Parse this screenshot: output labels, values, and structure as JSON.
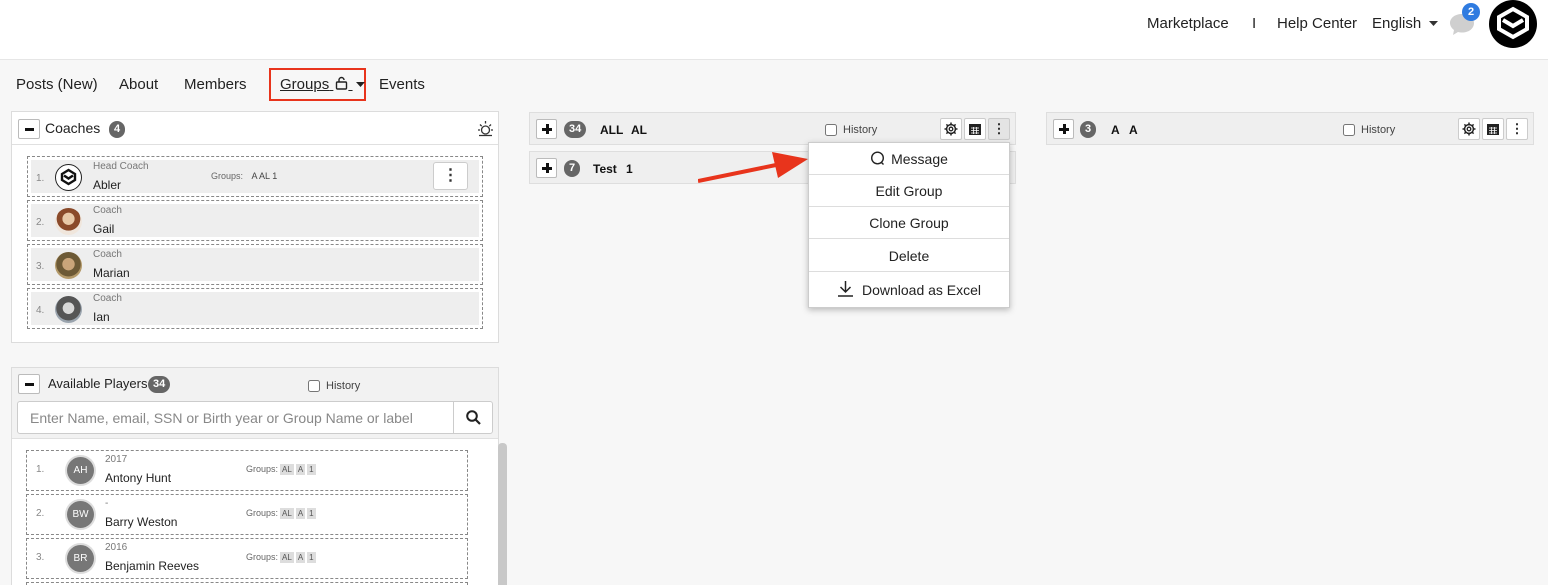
{
  "topbar": {
    "marketplace": "Marketplace",
    "separator": "I",
    "help_center": "Help Center",
    "language": "English",
    "chat_count": "2",
    "icons": {
      "chat": "chat-bubble-icon",
      "logo": "brand-logo-icon",
      "caret": "caret-down-icon"
    }
  },
  "tabs": [
    {
      "label": "Posts (New)"
    },
    {
      "label": "About"
    },
    {
      "label": "Members"
    },
    {
      "label": "Groups"
    },
    {
      "label": "Events"
    }
  ],
  "coaches": {
    "title": "Coaches",
    "count": "4",
    "rows": [
      {
        "num": "1.",
        "role": "Head Coach",
        "name": "Abler",
        "groups_label": "Groups:",
        "groups": "A  AL  1"
      },
      {
        "num": "2.",
        "role": "Coach",
        "name": "Gail"
      },
      {
        "num": "3.",
        "role": "Coach",
        "name": "Marian"
      },
      {
        "num": "4.",
        "role": "Coach",
        "name": "Ian"
      }
    ]
  },
  "players": {
    "title": "Available Players",
    "count": "34",
    "history_label": "History",
    "search_placeholder": "Enter Name, email, SSN or Birth year or Group Name or label",
    "groups_label": "Groups:",
    "rows": [
      {
        "num": "1.",
        "initials": "AH",
        "year": "2017",
        "name": "Antony Hunt",
        "tags": [
          "AL",
          "A",
          "1"
        ]
      },
      {
        "num": "2.",
        "initials": "BW",
        "year": "-",
        "name": "Barry Weston",
        "tags": [
          "AL",
          "A",
          "1"
        ]
      },
      {
        "num": "3.",
        "initials": "BR",
        "year": "2016",
        "name": "Benjamin Reeves",
        "tags": [
          "AL",
          "A",
          "1"
        ]
      }
    ]
  },
  "group_bars": {
    "bar1": {
      "count": "34",
      "label1": "ALL",
      "label2": "AL",
      "history_label": "History"
    },
    "bar2": {
      "count": "7",
      "label1": "Test",
      "label2": "1"
    },
    "bar3": {
      "count": "3",
      "label1": "A",
      "label2": "A",
      "history_label": "History"
    }
  },
  "menu": {
    "items": [
      "Message",
      "Edit Group",
      "Clone Group",
      "Delete",
      "Download as Excel"
    ]
  },
  "colors": {
    "highlight": "#e8341c",
    "badge": "#2f7be0",
    "count_badge": "#666666"
  }
}
